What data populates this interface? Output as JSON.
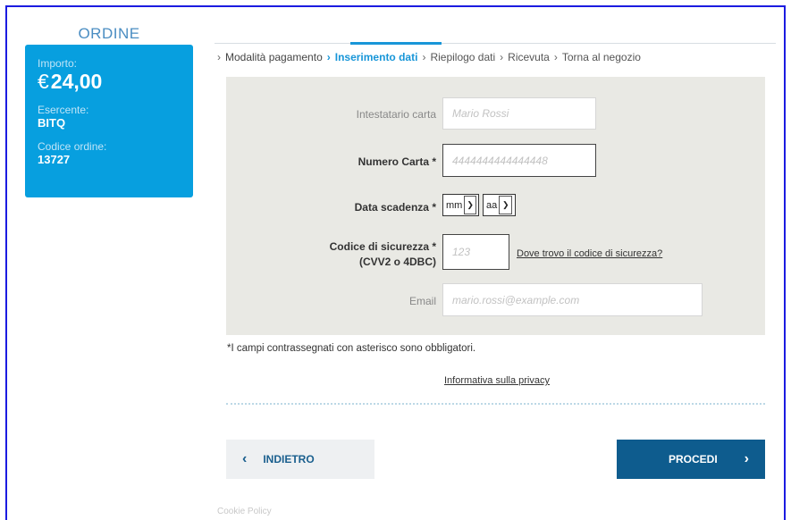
{
  "order": {
    "title": "ORDINE",
    "amount_label": "Importo:",
    "currency": "€",
    "amount": "24,00",
    "merchant_label": "Esercente:",
    "merchant": "BITQ",
    "order_code_label": "Codice ordine:",
    "order_code": "13727"
  },
  "steps": [
    {
      "label": "Modalità pagamento",
      "state": "done"
    },
    {
      "label": "Inserimento dati",
      "state": "active"
    },
    {
      "label": "Riepilogo dati",
      "state": "pending"
    },
    {
      "label": "Ricevuta",
      "state": "pending"
    },
    {
      "label": "Torna al negozio",
      "state": "pending"
    }
  ],
  "form": {
    "holder_label": "Intestatario carta",
    "holder_placeholder": "Mario Rossi",
    "card_label": "Numero Carta *",
    "card_placeholder": "4444444444444448",
    "expiry_label": "Data scadenza *",
    "expiry_month": "mm",
    "expiry_year": "aa",
    "cvv_label_line1": "Codice di sicurezza *",
    "cvv_label_line2": "(CVV2 o 4DBC)",
    "cvv_placeholder": "123",
    "cvv_help_link": "Dove trovo il codice di sicurezza?",
    "email_label": "Email",
    "email_placeholder": "mario.rossi@example.com"
  },
  "required_note": "*I campi contrassegnati con asterisco sono obbligatori.",
  "privacy_link": "Informativa sulla privacy",
  "buttons": {
    "back_label": "INDIETRO",
    "next_label": "PROCEDI"
  },
  "footer": {
    "cookie_link": "Cookie Policy"
  },
  "colors": {
    "accent": "#079fdf",
    "primary_button": "#0e5c8e",
    "active_step": "#1896d8"
  }
}
